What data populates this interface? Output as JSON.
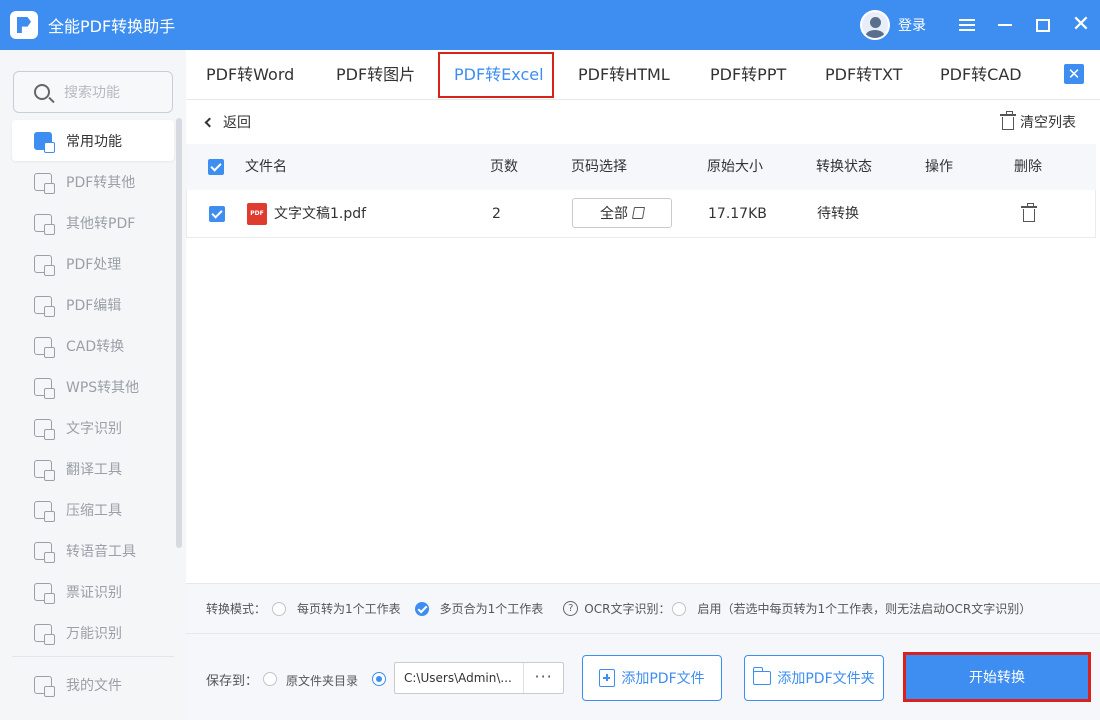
{
  "app": {
    "title": "全能PDF转换助手",
    "login": "登录"
  },
  "sidebar": {
    "search_placeholder": "搜索功能",
    "items": [
      {
        "label": "常用功能",
        "icon": "common-functions-icon",
        "active": true
      },
      {
        "label": "PDF转其他",
        "icon": "pdf-to-other-icon"
      },
      {
        "label": "其他转PDF",
        "icon": "other-to-pdf-icon"
      },
      {
        "label": "PDF处理",
        "icon": "pdf-process-icon"
      },
      {
        "label": "PDF编辑",
        "icon": "pdf-edit-icon"
      },
      {
        "label": "CAD转换",
        "icon": "cad-convert-icon"
      },
      {
        "label": "WPS转其他",
        "icon": "wps-convert-icon"
      },
      {
        "label": "文字识别",
        "icon": "text-recognition-icon"
      },
      {
        "label": "翻译工具",
        "icon": "translate-icon"
      },
      {
        "label": "压缩工具",
        "icon": "compress-icon"
      },
      {
        "label": "转语音工具",
        "icon": "speech-icon"
      },
      {
        "label": "票证识别",
        "icon": "ticket-recognition-icon"
      },
      {
        "label": "万能识别",
        "icon": "universal-recognition-icon"
      }
    ],
    "my_files": "我的文件"
  },
  "tabs": [
    {
      "label": "PDF转Word"
    },
    {
      "label": "PDF转图片"
    },
    {
      "label": "PDF转Excel",
      "active": true
    },
    {
      "label": "PDF转HTML"
    },
    {
      "label": "PDF转PPT"
    },
    {
      "label": "PDF转TXT"
    },
    {
      "label": "PDF转CAD"
    }
  ],
  "toolbar": {
    "back": "返回",
    "clear_list": "清空列表"
  },
  "table": {
    "headers": {
      "filename": "文件名",
      "pages": "页数",
      "page_select": "页码选择",
      "size": "原始大小",
      "status": "转换状态",
      "action": "操作",
      "delete": "删除"
    },
    "rows": [
      {
        "filename": "文字文稿1.pdf",
        "pages": "2",
        "page_select": "全部",
        "size": "17.17KB",
        "status": "待转换",
        "checked": true
      }
    ]
  },
  "mode": {
    "label": "转换模式：",
    "option1": "每页转为1个工作表",
    "option2": "多页合为1个工作表",
    "selected": "option2",
    "ocr_label": "OCR文字识别：",
    "ocr_option": "启用（若选中每页转为1个工作表，则无法启动OCR文字识别）"
  },
  "bottom": {
    "save_to": "保存到：",
    "source_dir": "原文件夹目录",
    "path": "C:\\Users\\Admin\\...",
    "path_more": "···",
    "add_file": "添加PDF文件",
    "add_folder": "添加PDF文件夹",
    "start": "开始转换"
  },
  "colors": {
    "accent": "#3d8ef0",
    "highlight": "#d9221c",
    "pdf_icon": "#e03b2f"
  }
}
